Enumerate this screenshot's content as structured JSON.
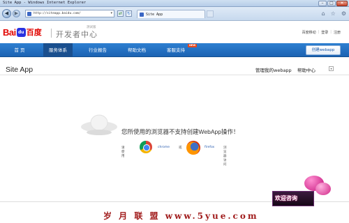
{
  "window": {
    "title": "Site App - Windows Internet Explorer",
    "controls": [
      "minimize",
      "maximize",
      "close"
    ]
  },
  "browser": {
    "address": "http://siteapp.baidu.com/",
    "tab_title": "Site App"
  },
  "header": {
    "logo_text_bai": "Bai",
    "logo_text_du_badge": "du",
    "logo_text_cn": "百度",
    "dev_center": "开发者中心",
    "beta_label": "测试版",
    "top_links": [
      "百度移动",
      "登录",
      "注册"
    ]
  },
  "menu": {
    "items": [
      "首 页",
      "服务体系",
      "行业报告",
      "帮助文档",
      "客服支持"
    ],
    "active_index": 1,
    "new_badge": "NEW",
    "create_button": "创建webapp"
  },
  "subheader": {
    "title": "Site App",
    "manage_label": "管理我的webapp",
    "help_label": "帮助中心"
  },
  "main": {
    "unsupported_message": "您所使用的浏览器不支持创建WebApp操作！",
    "please_use": "请使用",
    "chrome_label": "chrome",
    "or": "或",
    "firefox_label": "firefox",
    "visit_suffix": "浏览器访问"
  },
  "chat_widget": {
    "label": "欢迎咨询"
  },
  "watermark": {
    "text": "岁 月 联 盟   www.5yue.com"
  },
  "colors": {
    "menu_blue": "#1c63b3",
    "baidu_red": "#e10602",
    "baidu_blue": "#2932e1"
  }
}
